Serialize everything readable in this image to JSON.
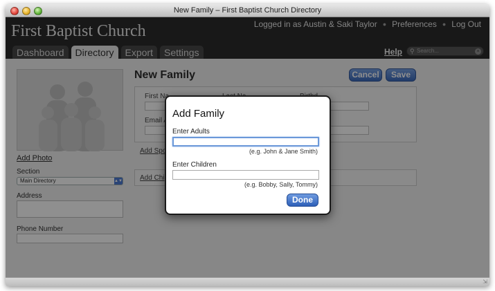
{
  "window": {
    "title": "New Family – First Baptist Church Directory"
  },
  "header": {
    "brand": "First Baptist Church",
    "logged_in": "Logged in as Austin & Saki Taylor",
    "preferences": "Preferences",
    "logout": "Log Out",
    "help": "Help",
    "search_placeholder": "Search..."
  },
  "tabs": [
    {
      "label": "Dashboard",
      "active": false
    },
    {
      "label": "Directory",
      "active": true
    },
    {
      "label": "Export",
      "active": false
    },
    {
      "label": "Settings",
      "active": false
    }
  ],
  "sidebar": {
    "add_photo": "Add Photo",
    "section_label": "Section",
    "section_value": "Main Directory",
    "address_label": "Address",
    "phone_label": "Phone Number"
  },
  "main": {
    "title": "New Family",
    "cancel": "Cancel",
    "save": "Save",
    "first_name_label": "First Na",
    "last_name_label": "Last Na",
    "birthday_label": "Birthd",
    "email_label": "Email A",
    "add_spouse": "Add Spo",
    "add_child": "Add Chi"
  },
  "modal": {
    "title": "Add Family",
    "adults_label": "Enter Adults",
    "adults_value": "",
    "adults_hint": "(e.g. John & Jane Smith)",
    "children_label": "Enter Children",
    "children_value": "",
    "children_hint": "(e.g. Bobby, Sally, Tommy)",
    "done": "Done"
  },
  "colors": {
    "accent_blue": "#2d5fb8",
    "header_bg": "#1b1b1b"
  }
}
